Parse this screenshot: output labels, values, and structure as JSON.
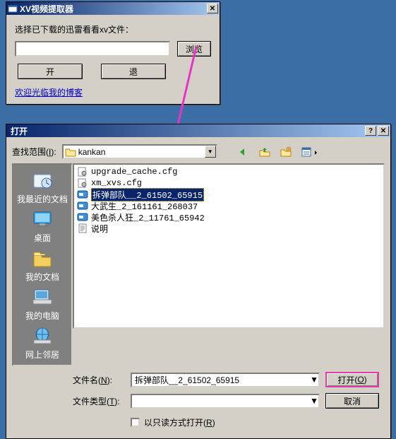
{
  "win1": {
    "title": "XV视频提取器",
    "prompt": "选择已下载的迅雷看看xv文件：",
    "input_value": "",
    "browse": "浏览",
    "open_btn": "开",
    "back_btn": "退",
    "blog_link": "欢迎光临我的博客"
  },
  "win2": {
    "title": "打开",
    "lookin_label": "查找范围",
    "lookin_accel": "I",
    "lookin_value": "kankan",
    "toolbar_icons": [
      "back-icon",
      "up-icon",
      "new-folder-icon",
      "views-icon"
    ],
    "places": [
      {
        "label": "我最近的文档",
        "icon": "recent"
      },
      {
        "label": "桌面",
        "icon": "desktop"
      },
      {
        "label": "我的文档",
        "icon": "mydocs"
      },
      {
        "label": "我的电脑",
        "icon": "mycomputer"
      },
      {
        "label": "网上邻居",
        "icon": "network"
      }
    ],
    "files": [
      {
        "name": "upgrade_cache.cfg",
        "type": "cfg",
        "selected": false
      },
      {
        "name": "xm_xvs.cfg",
        "type": "cfg",
        "selected": false
      },
      {
        "name": "拆弹部队__2_61502_65915",
        "type": "xv",
        "selected": true
      },
      {
        "name": "大武生_2_161161_268037",
        "type": "xv",
        "selected": false
      },
      {
        "name": "美色杀人狂_2_11761_65942",
        "type": "xv",
        "selected": false
      },
      {
        "name": "说明",
        "type": "txt",
        "selected": false
      }
    ],
    "filename_label": "文件名",
    "filename_accel": "N",
    "filename_value": "拆弹部队__2_61502_65915",
    "filetype_label": "文件类型",
    "filetype_accel": "T",
    "filetype_value": "",
    "open_btn": "打开",
    "open_accel": "O",
    "cancel_btn": "取消",
    "readonly_label": "以只读方式打开",
    "readonly_accel": "R",
    "readonly_checked": false
  }
}
